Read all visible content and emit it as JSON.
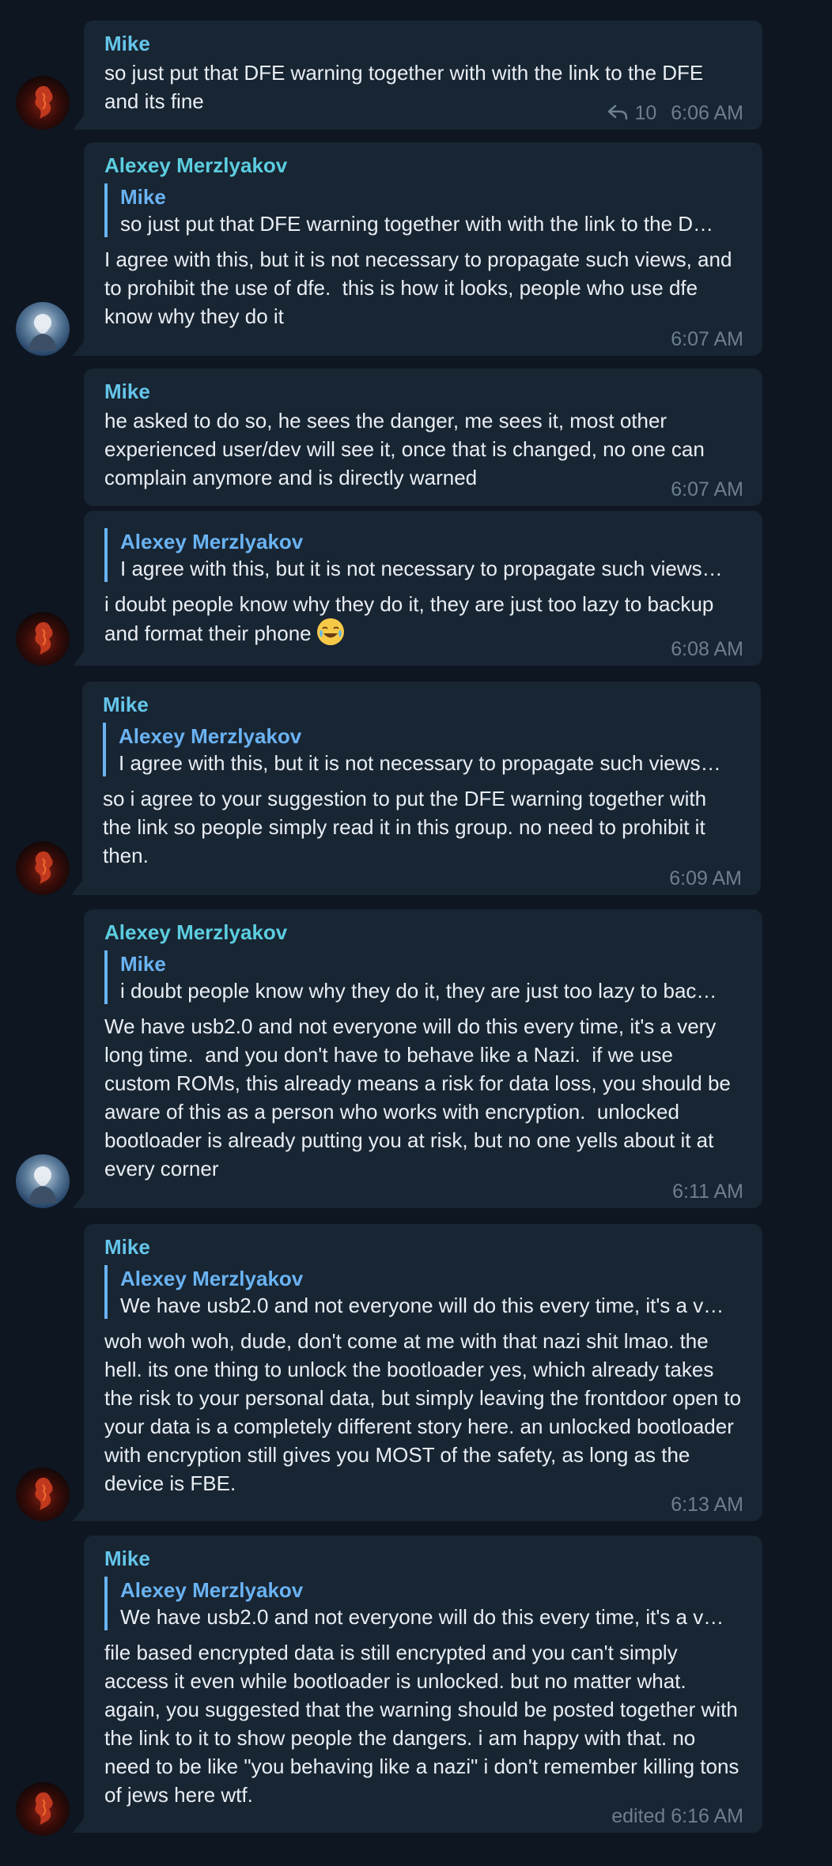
{
  "colors": {
    "background": "#0e1621",
    "bubble": "#182533",
    "name_accent": "#6ab3f3",
    "text": "#e9eef4",
    "meta": "#6d7f8f"
  },
  "messages": [
    {
      "sender": "Mike",
      "text": "so just put that DFE warning together with with the link to the DFE and its fine",
      "replies_count": "10",
      "time": "6:06 AM",
      "avatar": "mike-avatar-icon"
    },
    {
      "sender": "Alexey Merzlyakov",
      "reply": {
        "name": "Mike",
        "text": "so just put that DFE warning together with with the link to the D…"
      },
      "text": "I agree with this, but it is not necessary to propagate such views, and to prohibit the use of dfe.  this is how it looks, people who use dfe know why they do it",
      "time": "6:07 AM",
      "avatar": "alexey-avatar-icon"
    },
    {
      "sender": "Mike",
      "text": "he asked to do so, he sees the danger, me sees it, most other experienced user/dev will see it, once that is changed, no one can complain anymore and is directly warned",
      "time": "6:07 AM"
    },
    {
      "reply": {
        "name": "Alexey Merzlyakov",
        "text": "I agree with this, but it is not necessary to propagate such views…"
      },
      "text": "i doubt people know why they do it, they are just too lazy to backup and format their phone",
      "emoji": "face-with-tears-of-joy-icon",
      "time": "6:08 AM",
      "avatar": "mike-avatar-icon"
    },
    {
      "sender": "Mike",
      "reply": {
        "name": "Alexey Merzlyakov",
        "text": "I agree with this, but it is not necessary to propagate such views…"
      },
      "text": "so i agree to your suggestion to put the DFE warning together with the link so people simply read it in this group. no need to prohibit it then.",
      "time": "6:09 AM",
      "avatar": "mike-avatar-icon"
    },
    {
      "sender": "Alexey Merzlyakov",
      "reply": {
        "name": "Mike",
        "text": "i doubt people know why they do it, they are just too lazy to bac…"
      },
      "text": "We have usb2.0 and not everyone will do this every time, it's a very long time.  and you don't have to behave like a Nazi.  if we use custom ROMs, this already means a risk for data loss, you should be aware of this as a person who works with encryption.  unlocked bootloader is already putting you at risk, but no one yells about it at every corner",
      "time": "6:11 AM",
      "avatar": "alexey-avatar-icon"
    },
    {
      "sender": "Mike",
      "reply": {
        "name": "Alexey Merzlyakov",
        "text": "We have usb2.0 and not everyone will do this every time, it's a v…"
      },
      "text": "woh woh woh, dude, don't come at me with that nazi shit lmao. the hell. its one thing to unlock the bootloader yes, which already takes the risk to your personal data, but simply leaving the frontdoor open to your data is a completely different story here. an unlocked bootloader with encryption still gives you MOST of the safety, as long as the device is FBE.",
      "time": "6:13 AM",
      "avatar": "mike-avatar-icon"
    },
    {
      "sender": "Mike",
      "reply": {
        "name": "Alexey Merzlyakov",
        "text": "We have usb2.0 and not everyone will do this every time, it's a v…"
      },
      "text": "file based encrypted data is still encrypted and you can't simply access it even while bootloader is unlocked. but no matter what. again, you suggested that the warning should be posted together with the link to it to show people the dangers. i am happy with that. no need to be like \"you behaving like a nazi\" i don't remember killing tons of jews here wtf.",
      "time": "edited 6:16 AM",
      "avatar": "mike-avatar-icon"
    }
  ]
}
